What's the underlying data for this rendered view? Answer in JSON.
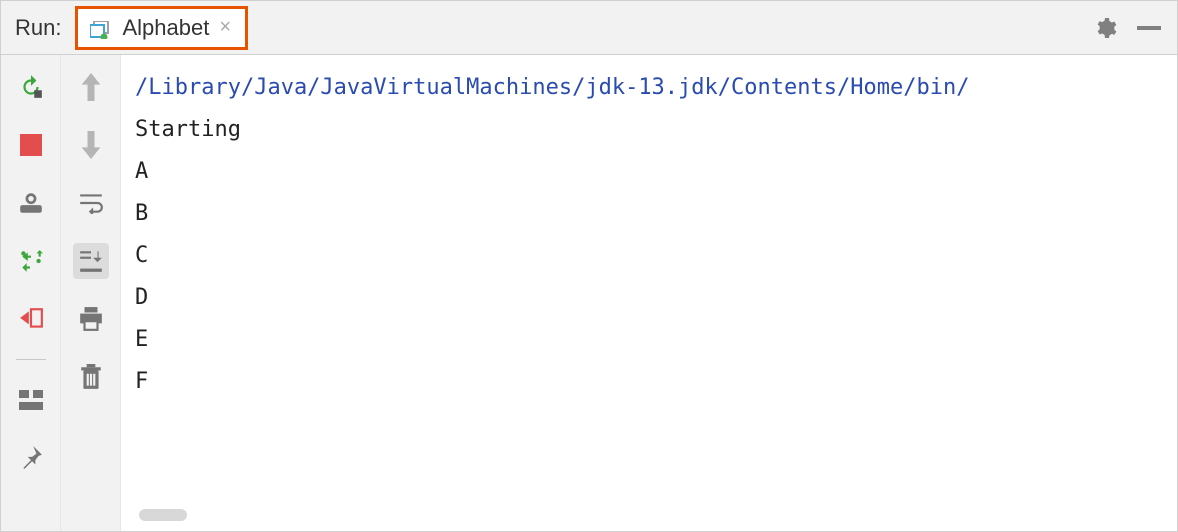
{
  "header": {
    "run_label": "Run:",
    "tab_name": "Alphabet"
  },
  "console": {
    "command_line": "/Library/Java/JavaVirtualMachines/jdk-13.jdk/Contents/Home/bin/",
    "lines": [
      "Starting",
      "A",
      "B",
      "C",
      "D",
      "E",
      "F"
    ]
  }
}
